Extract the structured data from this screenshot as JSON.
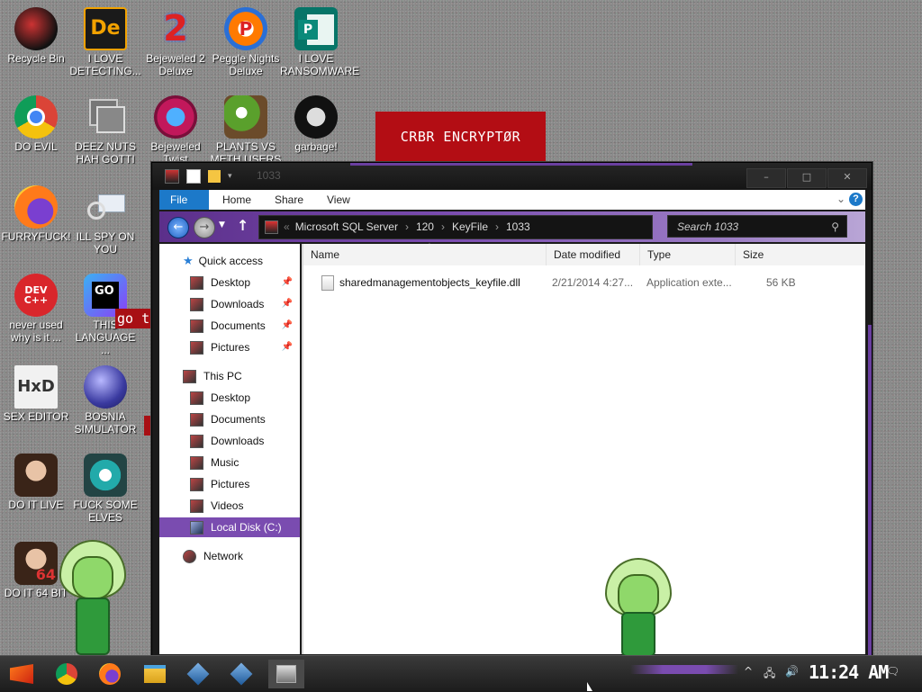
{
  "desktop": {
    "icons": [
      {
        "label": "Recycle Bin"
      },
      {
        "label": "I LOVE DETECTING..."
      },
      {
        "label": "Bejeweled 2 Deluxe"
      },
      {
        "label": "Peggle Nights Deluxe"
      },
      {
        "label": "I LOVE RANSOMWARE"
      },
      {
        "label": "DO EVIL"
      },
      {
        "label": "DEEZ NUTS HAH GOTTI"
      },
      {
        "label": "Bejeweled Twist"
      },
      {
        "label": "PLANTS VS METH USERS"
      },
      {
        "label": "garbage!"
      },
      {
        "label": "FURRYFUCK!"
      },
      {
        "label": "ILL SPY ON YOU"
      },
      {
        "label": "never used why is it ..."
      },
      {
        "label": "THIS LANGUAGE ..."
      },
      {
        "label": "SEX EDITOR"
      },
      {
        "label": "BOSNIA SIMULATOR"
      },
      {
        "label": "DO IT LIVE"
      },
      {
        "label": "FUCK SOME ELVES"
      },
      {
        "label": "DO IT 64 BIT"
      }
    ],
    "banner": "CRBR ENCRYPTØR",
    "goto_text": "go to",
    "icon_badges": {
      "de": "De",
      "two": "2",
      "p": "P",
      "go": "GO",
      "dev": "DEV C++",
      "hxd": "HxD",
      "num64": "64"
    }
  },
  "explorer": {
    "title": "1033",
    "window_buttons": {
      "minimize": "–",
      "maximize": "□",
      "close": "✕"
    },
    "ribbon": {
      "tabs": [
        "File",
        "Home",
        "Share",
        "View"
      ],
      "help": "?"
    },
    "breadcrumb": [
      "Microsoft SQL Server",
      "120",
      "KeyFile",
      "1033"
    ],
    "breadcrumb_lead": "«",
    "search_placeholder": "Search 1033",
    "nav": {
      "quick_access": "Quick access",
      "quick_items": [
        "Desktop",
        "Downloads",
        "Documents",
        "Pictures"
      ],
      "this_pc": "This PC",
      "pc_items": [
        "Desktop",
        "Documents",
        "Downloads",
        "Music",
        "Pictures",
        "Videos"
      ],
      "local_disk": "Local Disk (C:)",
      "network": "Network"
    },
    "columns": [
      "Name",
      "Date modified",
      "Type",
      "Size"
    ],
    "files": [
      {
        "name": "sharedmanagementobjects_keyfile.dll",
        "date": "2/21/2014 4:27...",
        "type": "Application exte...",
        "size": "56 KB"
      }
    ]
  },
  "taskbar": {
    "clock": "11:24 AM",
    "apps": [
      "start-icon",
      "chrome-icon",
      "firefox-icon",
      "file-explorer-icon",
      "virtualbox-icon",
      "virtualbox-icon",
      "terminal-icon"
    ]
  },
  "colors": {
    "accent_purple": "#7a4cb0",
    "banner_red": "#b30d14",
    "ribbon_blue": "#1c79c9"
  }
}
